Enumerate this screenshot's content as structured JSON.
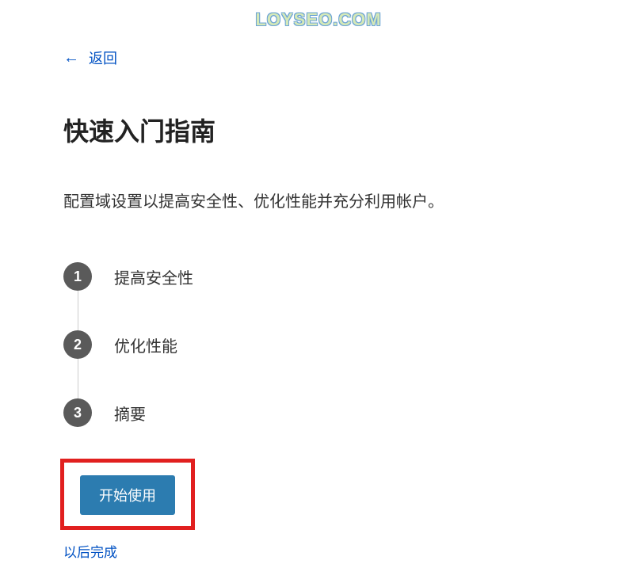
{
  "watermark": "LOYSEO.COM",
  "back": {
    "label": "返回"
  },
  "title": "快速入门指南",
  "description": "配置域设置以提高安全性、优化性能并充分利用帐户。",
  "steps": [
    {
      "number": "1",
      "label": "提高安全性"
    },
    {
      "number": "2",
      "label": "优化性能"
    },
    {
      "number": "3",
      "label": "摘要"
    }
  ],
  "actions": {
    "start_label": "开始使用",
    "later_label": "以后完成"
  }
}
